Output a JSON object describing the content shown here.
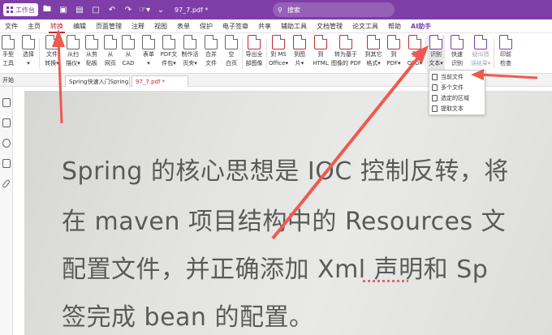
{
  "titlebar": {
    "workspace_label": "工作台",
    "file_name": "97_7.pdf *",
    "search_placeholder": "搜索"
  },
  "menubar": {
    "items": [
      "文件",
      "主页",
      "转换",
      "编辑",
      "页面管理",
      "注释",
      "视图",
      "表单",
      "保护",
      "电子签章",
      "共享",
      "辅助工具",
      "文档管理",
      "论文工具",
      "帮助",
      "AI助手"
    ],
    "active": "转换"
  },
  "ribbon": {
    "buttons": [
      {
        "name": "hand-tool",
        "line1": "手型",
        "line2": "工具"
      },
      {
        "name": "select",
        "line1": "选择",
        "line2": "▾"
      },
      {
        "name": "file-convert",
        "line1": "文件",
        "line2": "转换▾"
      },
      {
        "name": "from-scanner",
        "line1": "从扫",
        "line2": "描仪▾"
      },
      {
        "name": "from-clipboard",
        "line1": "从剪",
        "line2": "贴板"
      },
      {
        "name": "from-webpage",
        "line1": "从",
        "line2": "网页"
      },
      {
        "name": "from-cad",
        "line1": "从",
        "line2": "CAD"
      },
      {
        "name": "form",
        "line1": "表单",
        "line2": "▾"
      },
      {
        "name": "pdf-portfolio",
        "line1": "PDF文",
        "line2": "件包▾"
      },
      {
        "name": "make-live-page",
        "line1": "制作活",
        "line2": "页夹▾"
      },
      {
        "name": "merge-files",
        "line1": "合并",
        "line2": "文件"
      },
      {
        "name": "blank-page",
        "line1": "空",
        "line2": "白页"
      },
      {
        "name": "export-images",
        "line1": "导出全",
        "line2": "部图像"
      },
      {
        "name": "to-ms-office",
        "line1": "到 MS",
        "line2": "Office▾"
      },
      {
        "name": "to-image",
        "line1": "到图",
        "line2": "片▾"
      },
      {
        "name": "to-html",
        "line1": "到",
        "line2": "HTML"
      },
      {
        "name": "to-image-pdf",
        "line1": "转为基于",
        "line2": "图像的 PDF"
      },
      {
        "name": "to-other-format",
        "line1": "到其它",
        "line2": "格式▾"
      },
      {
        "name": "to-pdf",
        "line1": "到",
        "line2": "PDF▾"
      },
      {
        "name": "to-ofd",
        "line1": "到",
        "line2": "OFD▾"
      },
      {
        "name": "recognize-text",
        "line1": "识别",
        "line2": "文本▾"
      },
      {
        "name": "quick-recognize",
        "line1": "快速",
        "line2": "识别"
      },
      {
        "name": "recognition-results",
        "line1": "疑似错",
        "line2": "误结果▾"
      },
      {
        "name": "preflight",
        "line1": "印前",
        "line2": "检查"
      }
    ]
  },
  "tabs": {
    "start_label": "开始",
    "doc_tabs": [
      "Spring快速入门Spring...",
      "97_7.pdf *"
    ]
  },
  "dropdown": {
    "items": [
      "当前文件",
      "多个文件",
      "选定的区域",
      "提取文本"
    ]
  },
  "document": {
    "lines": [
      "Spring 的核心思想是 IOC 控制反转，将",
      "在 maven 项目结构中的 Resources 文",
      "配置文件，并正确添加  Xml 声明和 Sp",
      "签完成 bean 的配置。"
    ]
  },
  "colors": {
    "title_bar": "#7e3ea8",
    "active_menu": "#c12d2d",
    "annotation_arrow": "#ee5a50"
  }
}
